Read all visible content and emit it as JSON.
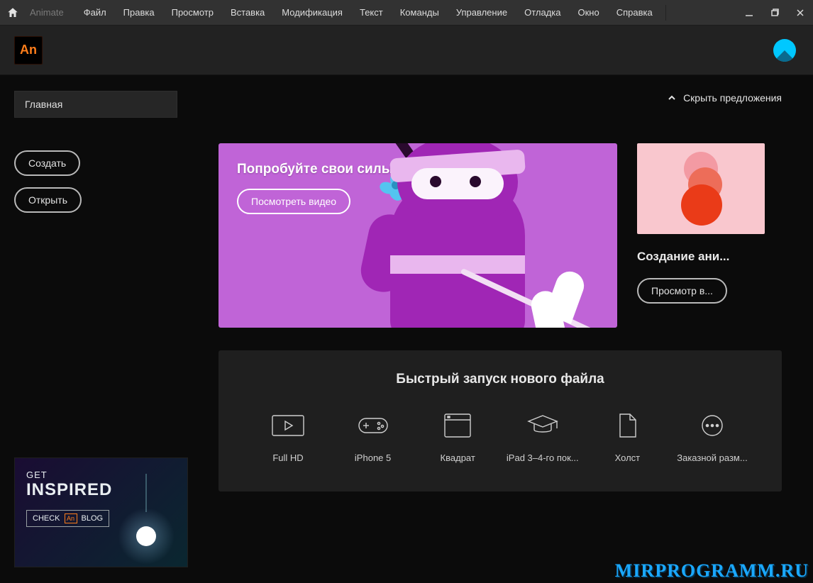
{
  "app_name": "Animate",
  "menu": [
    "Файл",
    "Правка",
    "Просмотр",
    "Вставка",
    "Модификация",
    "Текст",
    "Команды",
    "Управление",
    "Отладка",
    "Окно",
    "Справка"
  ],
  "sidebar": {
    "tab_label": "Главная",
    "create_label": "Создать",
    "open_label": "Открыть"
  },
  "inspire": {
    "line1": "GET",
    "line2": "INSPIRED",
    "check": "CHECK",
    "badge": "An",
    "blog": "BLOG"
  },
  "hide_offers_label": "Скрыть предложения",
  "hero": {
    "title": "Попробуйте свои силы в Animate",
    "button": "Посмотреть видео"
  },
  "side_card": {
    "title": "Создание ани...",
    "button": "Просмотр в..."
  },
  "quick": {
    "title": "Быстрый запуск нового файла",
    "presets": [
      {
        "label": "Full HD",
        "icon": "play"
      },
      {
        "label": "iPhone 5",
        "icon": "gamepad"
      },
      {
        "label": "Квадрат",
        "icon": "window"
      },
      {
        "label": "iPad 3–4-го пок...",
        "icon": "grad"
      },
      {
        "label": "Холст",
        "icon": "page"
      },
      {
        "label": "Заказной разм...",
        "icon": "more"
      }
    ]
  },
  "watermark": "MIRPROGRAMM.RU"
}
